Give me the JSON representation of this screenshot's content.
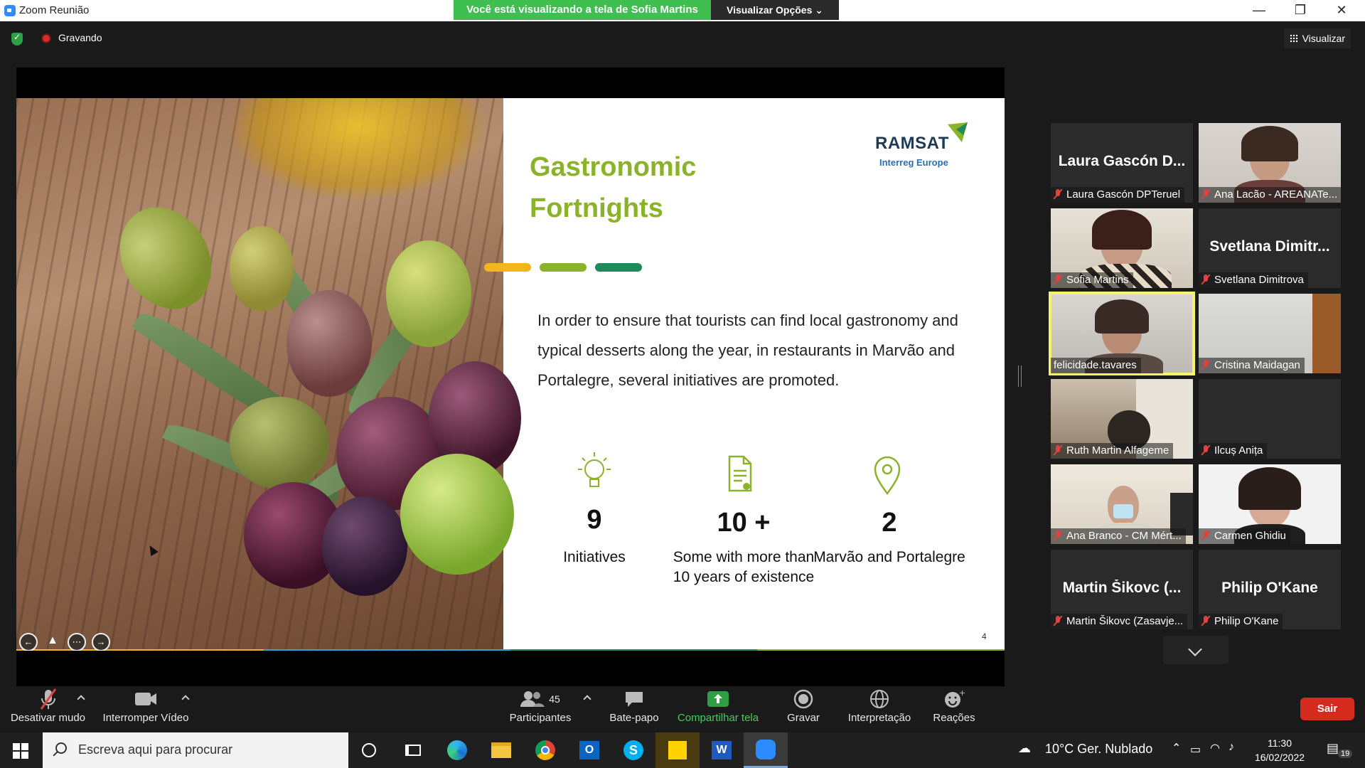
{
  "window": {
    "title": "Zoom Reunião",
    "share_banner": "Você está visualizando a tela de Sofia Martins",
    "view_options": "Visualizar Opções",
    "minimize": "—",
    "restore": "❐",
    "close": "✕"
  },
  "topbar": {
    "recording_label": "Gravando",
    "view_label": "Visualizar"
  },
  "slide": {
    "title": "Gastronomic Fortnights",
    "logo_main": "RAMSAT",
    "logo_sub": "Interreg Europe",
    "paragraph": "In order to ensure that tourists can find local gastronomy and typical desserts along the year, in restaurants in Marvão and Portalegre, several initiatives are promoted.",
    "stats": [
      {
        "number": "9",
        "label": "Initiatives",
        "icon": "lightbulb-icon"
      },
      {
        "number": "10 +",
        "label": "Some with more than 10 years of existence",
        "icon": "document-icon"
      },
      {
        "number": "2",
        "label": "Marvão and Portalegre",
        "icon": "map-pin-icon"
      }
    ],
    "page_number": "4",
    "accent_bars": [
      "#f2b51c",
      "#8ab32a",
      "#1f8a5a"
    ]
  },
  "participants": [
    {
      "big_name": "Laura Gascón D...",
      "label": "Laura Gascón DPTeruel",
      "muted": true,
      "video": false
    },
    {
      "big_name": "",
      "label": "Ana Lacão - AREANATe...",
      "muted": true,
      "video": true
    },
    {
      "big_name": "",
      "label": "Sofia Martins",
      "muted": true,
      "video": true
    },
    {
      "big_name": "Svetlana  Dimitr...",
      "label": "Svetlana Dimitrova",
      "muted": true,
      "video": false
    },
    {
      "big_name": "",
      "label": "felicidade.tavares",
      "muted": false,
      "video": true,
      "active": true
    },
    {
      "big_name": "",
      "label": "Cristina Maidagan",
      "muted": true,
      "video": true
    },
    {
      "big_name": "",
      "label": "Ruth Martin Alfageme",
      "muted": true,
      "video": true
    },
    {
      "big_name": "",
      "label": "Ilcuș Anița",
      "muted": true,
      "video": false
    },
    {
      "big_name": "",
      "label": "Ana Branco - CM Mért...",
      "muted": true,
      "video": true
    },
    {
      "big_name": "",
      "label": "Carmen Ghidiu",
      "muted": true,
      "video": true
    },
    {
      "big_name": "Martin Šikovc (...",
      "label": "Martin Šikovc (Zasavje...",
      "muted": true,
      "video": false
    },
    {
      "big_name": "Philip O'Kane",
      "label": "Philip O'Kane",
      "muted": true,
      "video": false
    }
  ],
  "toolbar": {
    "mute": "Desativar mudo",
    "video": "Interromper Vídeo",
    "participants": "Participantes",
    "participants_count": "45",
    "chat": "Bate-papo",
    "share": "Compartilhar tela",
    "record": "Gravar",
    "interpretation": "Interpretação",
    "reactions": "Reações",
    "leave": "Sair"
  },
  "taskbar": {
    "search_placeholder": "Escreva aqui para procurar",
    "weather": "10°C  Ger. Nublado",
    "time": "11:30",
    "date": "16/02/2022",
    "notifications": "19"
  }
}
